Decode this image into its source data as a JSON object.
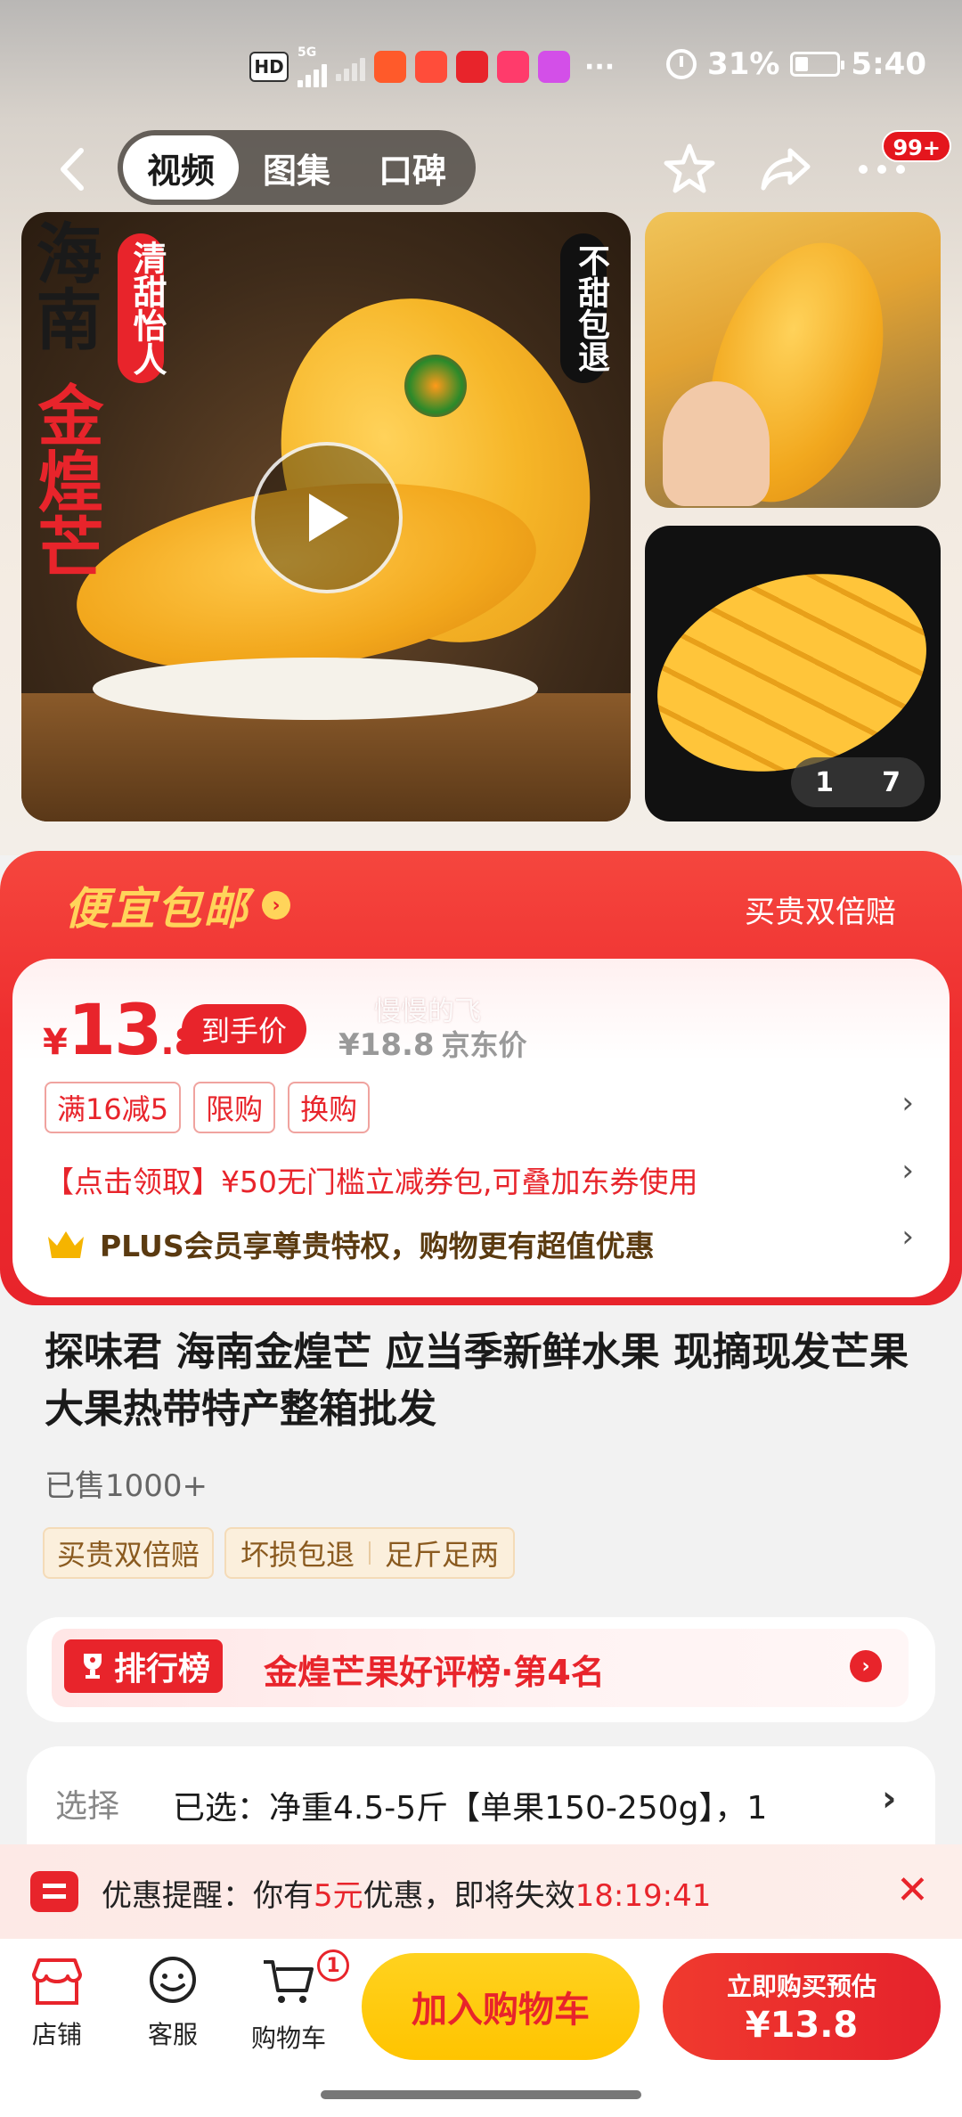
{
  "status_bar": {
    "hd_label": "HD",
    "network_label": "5G",
    "battery_percent": "31%",
    "battery_level": 0.31,
    "time": "5:40",
    "more": "···"
  },
  "nav": {
    "tabs": [
      {
        "label": "视频",
        "active": true
      },
      {
        "label": "图集",
        "active": false
      },
      {
        "label": "口碑",
        "active": false
      }
    ],
    "notification_badge": "99+"
  },
  "gallery": {
    "main_overlay": {
      "title_left": "海南",
      "title_red": "金煌芒",
      "tag_red": "清甜怡人",
      "tag_right": "不甜包退"
    },
    "pager_current": "1",
    "pager_total": "7"
  },
  "promo": {
    "title": "便宜包邮",
    "right_text": "买贵双倍赔",
    "watermark": "慢慢的飞"
  },
  "price": {
    "currency": "¥",
    "integer": "13",
    "decimal": ".8",
    "tag": "到手价",
    "jd_price": "¥18.8",
    "jd_label": "京东价",
    "tags": [
      "满16减5",
      "限购",
      "换购"
    ],
    "coupon_text": "【点击领取】¥50无门槛立减券包,可叠加东券使用",
    "plus_text": "PLUS会员享尊贵特权，购物更有超值优惠"
  },
  "product": {
    "title": "探味君 海南金煌芒 应当季新鲜水果 现摘现发芒果大果热带特产整箱批发",
    "sold": "已售1000+",
    "service_tags": [
      "买贵双倍赔",
      "坏损包退",
      "足斤足两"
    ]
  },
  "rank": {
    "badge": "排行榜",
    "text": "金煌芒果好评榜·第4名"
  },
  "selection": {
    "label": "选择",
    "value": "已选：净重4.5-5斤【单果150-250g】，1"
  },
  "reminder": {
    "prefix": "优惠提醒：你有",
    "amount": "5元",
    "middle": "优惠，即将失效",
    "countdown": "18:19:41"
  },
  "bottom_bar": {
    "store": "店铺",
    "service": "客服",
    "cart": "购物车",
    "cart_count": "1",
    "add_to_cart": "加入购物车",
    "buy_now_line1": "立即购买预估",
    "buy_now_price": "¥13.8"
  },
  "colors": {
    "brand_red": "#e8242b",
    "gold": "#ffd45a",
    "cart_yellow": "#ffc400"
  }
}
